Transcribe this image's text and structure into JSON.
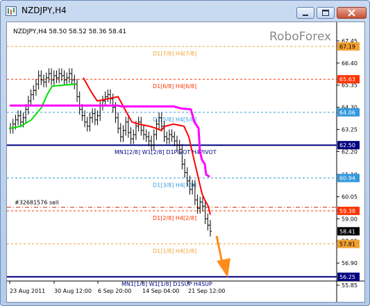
{
  "window": {
    "title": "NZDJPY,H4"
  },
  "chart": {
    "info": "NZDJPY,H4  58.50 58.52 58.36 58.41",
    "watermark": "RoboForex",
    "order_label": "#32681576 sell",
    "colors": {
      "candle": "#000000",
      "red_line": "#ff0000",
      "green_line": "#00dd00",
      "magenta_line": "#ff00ff",
      "navy": "#000080",
      "orange_arrow": "#ff8c1a",
      "current_price_bg": "#000000"
    },
    "y_ticks": [
      "67.45",
      "66.40",
      "65.35",
      "64.30",
      "63.25",
      "62.20",
      "61.10",
      "60.05",
      "59.00",
      "57.95",
      "56.90",
      "55.85"
    ],
    "x_labels": [
      "23 Aug 2011",
      "30 Aug 12:00",
      "6 Sep 20:00",
      "14 Sep 04:00",
      "21 Sep 12:00"
    ],
    "levels": [
      {
        "label": "D1[7/8] H4[7/8]",
        "price": 67.19,
        "price_text": "67.19",
        "color": "#f0a030",
        "style": "dashed",
        "badge_text_color": "#000"
      },
      {
        "label": "D1[6/8] H4[6/8]",
        "price": 65.63,
        "price_text": "65.63",
        "color": "#ff3300",
        "style": "dashed",
        "badge_text_color": "#fff"
      },
      {
        "label": "D1[5/8] H4[5/8]",
        "price": 64.06,
        "price_text": "64.06",
        "color": "#3399dd",
        "style": "dashed",
        "badge_text_color": "#fff"
      },
      {
        "label": "MN1[2/8] W1[2/8] D1PIVOT H4PIVOT",
        "price": 62.5,
        "price_text": "62.50",
        "color": "#000080",
        "style": "solid",
        "badge_text_color": "#fff"
      },
      {
        "label": "D1[3/8] H4[3/8]",
        "price": 60.94,
        "price_text": "60.94",
        "color": "#3399dd",
        "style": "dashed",
        "badge_text_color": "#fff"
      },
      {
        "label": "D1[2/8] H4[2/8]",
        "price": 59.38,
        "price_text": "59.38",
        "color": "#ff3300",
        "style": "dashed",
        "badge_text_color": "#fff"
      },
      {
        "label": "D1[1/8] H4[1/8]",
        "price": 57.81,
        "price_text": "57.81",
        "color": "#f0a030",
        "style": "dashed",
        "badge_text_color": "#000"
      },
      {
        "label": "MN1[1/8] W1[1/8] D1SUP H4SUP",
        "price": 56.25,
        "price_text": "56.25",
        "color": "#000080",
        "style": "solid",
        "badge_text_color": "#fff"
      }
    ],
    "current_price": {
      "price": 58.41,
      "price_text": "58.41"
    },
    "order_price": 59.55
  }
}
